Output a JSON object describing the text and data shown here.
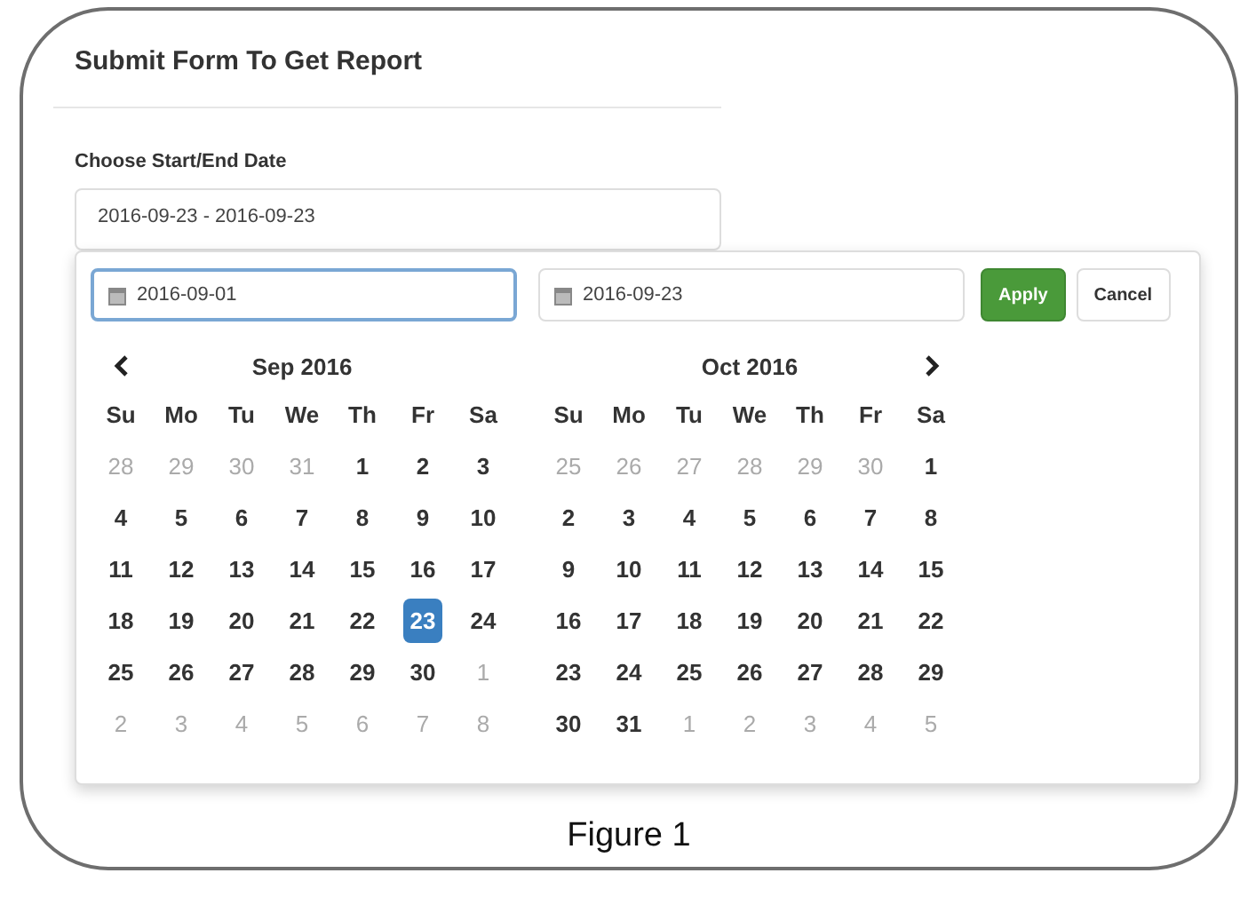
{
  "title": "Submit Form To Get Report",
  "date_label": "Choose Start/End Date",
  "range_field": {
    "value": "2016-09-23 - 2016-09-23"
  },
  "picker": {
    "start_field": {
      "value": "2016-09-01",
      "focused": true
    },
    "end_field": {
      "value": "2016-09-23",
      "focused": false
    },
    "buttons": [
      {
        "kind": "primary",
        "label": "Apply"
      },
      {
        "kind": "plain",
        "label": "Cancel"
      }
    ],
    "calendars": [
      {
        "title": "Sep 2016",
        "kind": "prev",
        "weekdays": [
          "Su",
          "Mo",
          "Tu",
          "We",
          "Th",
          "Fr",
          "Sa"
        ],
        "weeks": [
          [
            {
              "label": "28",
              "muted": true,
              "selected": false
            },
            {
              "label": "29",
              "muted": true,
              "selected": false
            },
            {
              "label": "30",
              "muted": true,
              "selected": false
            },
            {
              "label": "31",
              "muted": true,
              "selected": false
            },
            {
              "label": "1",
              "muted": false,
              "selected": false
            },
            {
              "label": "2",
              "muted": false,
              "selected": false
            },
            {
              "label": "3",
              "muted": false,
              "selected": false
            }
          ],
          [
            {
              "label": "4",
              "muted": false,
              "selected": false
            },
            {
              "label": "5",
              "muted": false,
              "selected": false
            },
            {
              "label": "6",
              "muted": false,
              "selected": false
            },
            {
              "label": "7",
              "muted": false,
              "selected": false
            },
            {
              "label": "8",
              "muted": false,
              "selected": false
            },
            {
              "label": "9",
              "muted": false,
              "selected": false
            },
            {
              "label": "10",
              "muted": false,
              "selected": false
            }
          ],
          [
            {
              "label": "11",
              "muted": false,
              "selected": false
            },
            {
              "label": "12",
              "muted": false,
              "selected": false
            },
            {
              "label": "13",
              "muted": false,
              "selected": false
            },
            {
              "label": "14",
              "muted": false,
              "selected": false
            },
            {
              "label": "15",
              "muted": false,
              "selected": false
            },
            {
              "label": "16",
              "muted": false,
              "selected": false
            },
            {
              "label": "17",
              "muted": false,
              "selected": false
            }
          ],
          [
            {
              "label": "18",
              "muted": false,
              "selected": false
            },
            {
              "label": "19",
              "muted": false,
              "selected": false
            },
            {
              "label": "20",
              "muted": false,
              "selected": false
            },
            {
              "label": "21",
              "muted": false,
              "selected": false
            },
            {
              "label": "22",
              "muted": false,
              "selected": false
            },
            {
              "label": "23",
              "muted": false,
              "selected": true
            },
            {
              "label": "24",
              "muted": false,
              "selected": false
            }
          ],
          [
            {
              "label": "25",
              "muted": false,
              "selected": false
            },
            {
              "label": "26",
              "muted": false,
              "selected": false
            },
            {
              "label": "27",
              "muted": false,
              "selected": false
            },
            {
              "label": "28",
              "muted": false,
              "selected": false
            },
            {
              "label": "29",
              "muted": false,
              "selected": false
            },
            {
              "label": "30",
              "muted": false,
              "selected": false
            },
            {
              "label": "1",
              "muted": true,
              "selected": false
            }
          ],
          [
            {
              "label": "2",
              "muted": true,
              "selected": false
            },
            {
              "label": "3",
              "muted": true,
              "selected": false
            },
            {
              "label": "4",
              "muted": true,
              "selected": false
            },
            {
              "label": "5",
              "muted": true,
              "selected": false
            },
            {
              "label": "6",
              "muted": true,
              "selected": false
            },
            {
              "label": "7",
              "muted": true,
              "selected": false
            },
            {
              "label": "8",
              "muted": true,
              "selected": false
            }
          ]
        ]
      },
      {
        "title": "Oct 2016",
        "kind": "next",
        "weekdays": [
          "Su",
          "Mo",
          "Tu",
          "We",
          "Th",
          "Fr",
          "Sa"
        ],
        "weeks": [
          [
            {
              "label": "25",
              "muted": true,
              "selected": false
            },
            {
              "label": "26",
              "muted": true,
              "selected": false
            },
            {
              "label": "27",
              "muted": true,
              "selected": false
            },
            {
              "label": "28",
              "muted": true,
              "selected": false
            },
            {
              "label": "29",
              "muted": true,
              "selected": false
            },
            {
              "label": "30",
              "muted": true,
              "selected": false
            },
            {
              "label": "1",
              "muted": false,
              "selected": false
            }
          ],
          [
            {
              "label": "2",
              "muted": false,
              "selected": false
            },
            {
              "label": "3",
              "muted": false,
              "selected": false
            },
            {
              "label": "4",
              "muted": false,
              "selected": false
            },
            {
              "label": "5",
              "muted": false,
              "selected": false
            },
            {
              "label": "6",
              "muted": false,
              "selected": false
            },
            {
              "label": "7",
              "muted": false,
              "selected": false
            },
            {
              "label": "8",
              "muted": false,
              "selected": false
            }
          ],
          [
            {
              "label": "9",
              "muted": false,
              "selected": false
            },
            {
              "label": "10",
              "muted": false,
              "selected": false
            },
            {
              "label": "11",
              "muted": false,
              "selected": false
            },
            {
              "label": "12",
              "muted": false,
              "selected": false
            },
            {
              "label": "13",
              "muted": false,
              "selected": false
            },
            {
              "label": "14",
              "muted": false,
              "selected": false
            },
            {
              "label": "15",
              "muted": false,
              "selected": false
            }
          ],
          [
            {
              "label": "16",
              "muted": false,
              "selected": false
            },
            {
              "label": "17",
              "muted": false,
              "selected": false
            },
            {
              "label": "18",
              "muted": false,
              "selected": false
            },
            {
              "label": "19",
              "muted": false,
              "selected": false
            },
            {
              "label": "20",
              "muted": false,
              "selected": false
            },
            {
              "label": "21",
              "muted": false,
              "selected": false
            },
            {
              "label": "22",
              "muted": false,
              "selected": false
            }
          ],
          [
            {
              "label": "23",
              "muted": false,
              "selected": false
            },
            {
              "label": "24",
              "muted": false,
              "selected": false
            },
            {
              "label": "25",
              "muted": false,
              "selected": false
            },
            {
              "label": "26",
              "muted": false,
              "selected": false
            },
            {
              "label": "27",
              "muted": false,
              "selected": false
            },
            {
              "label": "28",
              "muted": false,
              "selected": false
            },
            {
              "label": "29",
              "muted": false,
              "selected": false
            }
          ],
          [
            {
              "label": "30",
              "muted": false,
              "selected": false
            },
            {
              "label": "31",
              "muted": false,
              "selected": false
            },
            {
              "label": "1",
              "muted": true,
              "selected": false
            },
            {
              "label": "2",
              "muted": true,
              "selected": false
            },
            {
              "label": "3",
              "muted": true,
              "selected": false
            },
            {
              "label": "4",
              "muted": true,
              "selected": false
            },
            {
              "label": "5",
              "muted": true,
              "selected": false
            }
          ]
        ]
      }
    ]
  },
  "caption": "Figure 1"
}
